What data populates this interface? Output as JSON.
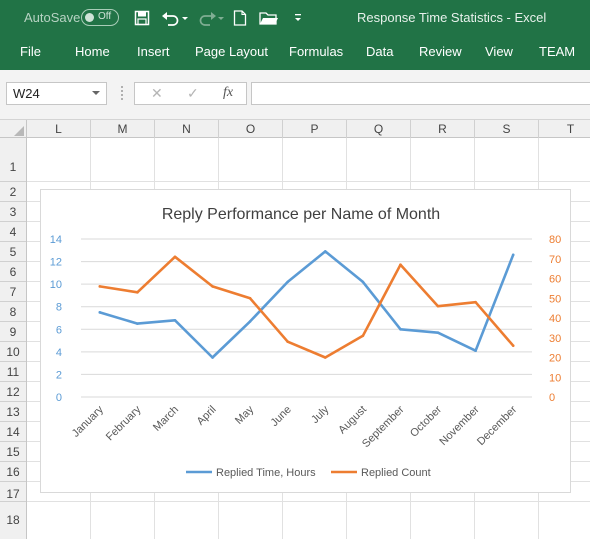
{
  "titlebar": {
    "autosave_label": "AutoSave",
    "autosave_state": "Off",
    "title": "Response Time Statistics  -  Excel"
  },
  "ribbon": {
    "tabs": [
      "File",
      "Home",
      "Insert",
      "Page Layout",
      "Formulas",
      "Data",
      "Review",
      "View",
      "TEAM"
    ]
  },
  "formula_bar": {
    "name_box": "W24",
    "cancel_symbol": "✕",
    "enter_symbol": "✓",
    "fx_symbol": "fx",
    "formula_value": ""
  },
  "grid": {
    "columns": [
      "L",
      "M",
      "N",
      "O",
      "P",
      "Q",
      "R",
      "S",
      "T"
    ],
    "rows": [
      "1",
      "2",
      "3",
      "4",
      "5",
      "6",
      "7",
      "8",
      "9",
      "10",
      "11",
      "12",
      "13",
      "14",
      "15",
      "16",
      "17",
      "18"
    ]
  },
  "colors": {
    "ribbon": "#217346",
    "series_time": "#5b9bd5",
    "series_count": "#ed7d31"
  },
  "chart_data": {
    "type": "line",
    "title": "Reply Performance per Name of Month",
    "categories": [
      "January",
      "February",
      "March",
      "April",
      "May",
      "June",
      "July",
      "August",
      "September",
      "October",
      "November",
      "December"
    ],
    "series": [
      {
        "name": "Replied Time, Hours",
        "axis": "left",
        "color": "#5b9bd5",
        "values": [
          7.5,
          6.5,
          6.8,
          3.5,
          6.7,
          10.2,
          12.9,
          10.2,
          6.0,
          5.7,
          4.1,
          12.6
        ]
      },
      {
        "name": "Replied Count",
        "axis": "right",
        "color": "#ed7d31",
        "values": [
          56,
          53,
          71,
          56,
          50,
          28,
          20,
          31,
          67,
          46,
          48,
          26
        ]
      }
    ],
    "y_left": {
      "min": 0,
      "max": 14,
      "ticks": [
        0,
        2,
        4,
        6,
        8,
        10,
        12,
        14
      ]
    },
    "y_right": {
      "min": 0,
      "max": 80,
      "ticks": [
        0,
        10,
        20,
        30,
        40,
        50,
        60,
        70,
        80
      ]
    },
    "grid": true,
    "legend": "bottom"
  }
}
